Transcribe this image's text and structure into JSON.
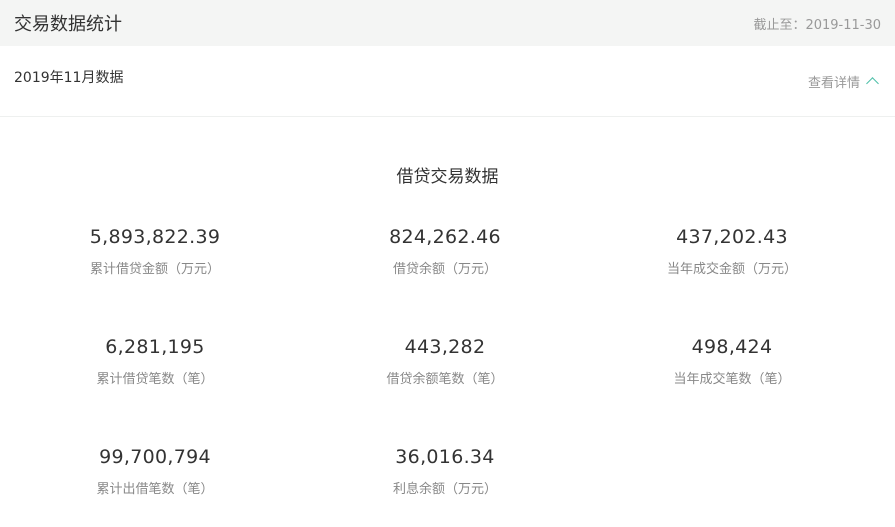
{
  "header": {
    "title": "交易数据统计",
    "as_of": "截止至：2019-11-30"
  },
  "subheader": {
    "title": "2019年11月数据",
    "detail_link": "查看详情"
  },
  "section": {
    "title": "借贷交易数据"
  },
  "stats": [
    {
      "value": "5,893,822.39",
      "label": "累计借贷金额（万元）"
    },
    {
      "value": "824,262.46",
      "label": "借贷余额（万元）"
    },
    {
      "value": "437,202.43",
      "label": "当年成交金额（万元）"
    },
    {
      "value": "6,281,195",
      "label": "累计借贷笔数（笔）"
    },
    {
      "value": "443,282",
      "label": "借贷余额笔数（笔）"
    },
    {
      "value": "498,424",
      "label": "当年成交笔数（笔）"
    },
    {
      "value": "99,700,794",
      "label": "累计出借笔数（笔）"
    },
    {
      "value": "36,016.34",
      "label": "利息余额（万元）"
    }
  ]
}
